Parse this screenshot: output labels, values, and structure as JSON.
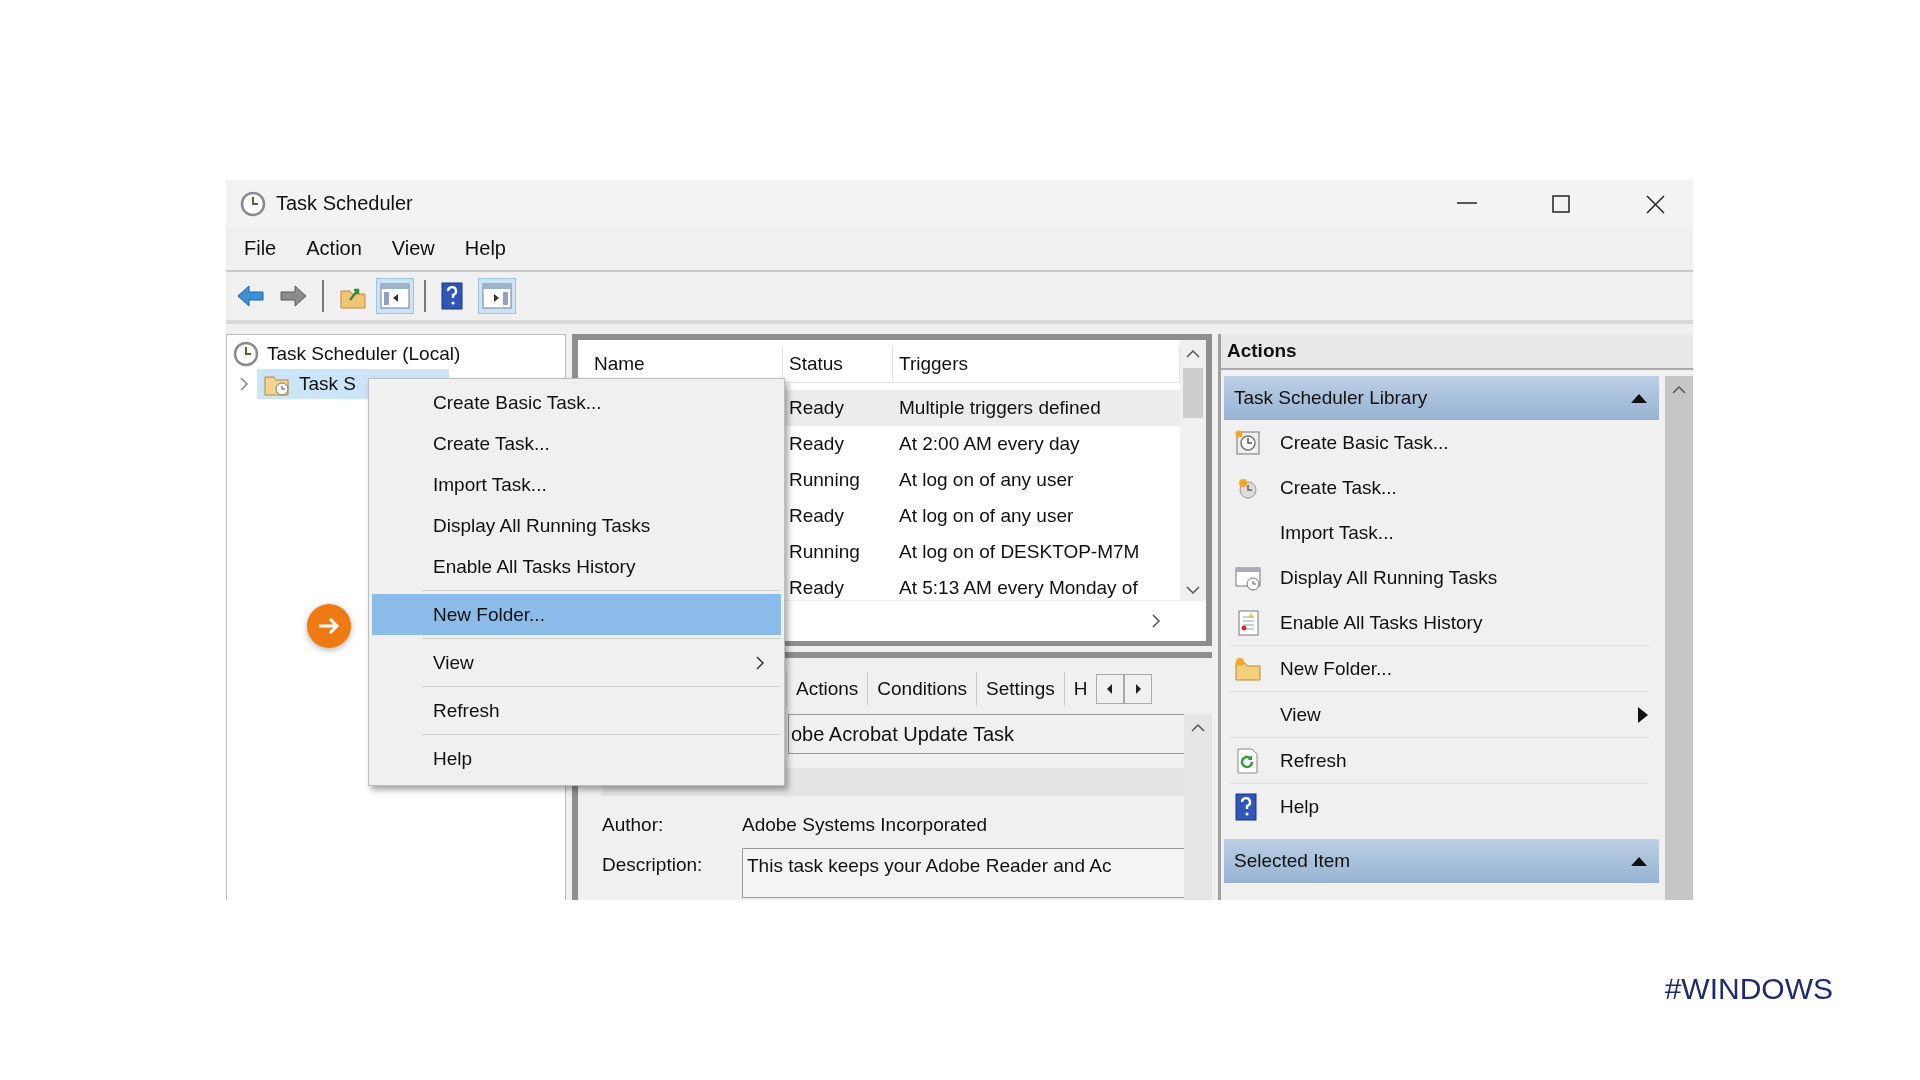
{
  "window": {
    "title": "Task Scheduler"
  },
  "menu_bar": [
    "File",
    "Action",
    "View",
    "Help"
  ],
  "toolbar": [
    [
      {
        "kind": "back",
        "pressed": false
      },
      {
        "kind": "forward",
        "pressed": false
      }
    ],
    [
      {
        "kind": "folder-up",
        "pressed": false
      },
      {
        "kind": "console-tree",
        "pressed": true
      }
    ],
    [
      {
        "kind": "help",
        "pressed": false
      },
      {
        "kind": "action-pane",
        "pressed": true
      }
    ]
  ],
  "tree": {
    "label": "Task Scheduler (Local)",
    "children": [
      {
        "label": "Task S",
        "selected": true,
        "expanded": false
      }
    ]
  },
  "task_list": {
    "columns": [
      "Name",
      "Status",
      "Triggers"
    ],
    "rows": [
      {
        "status": "Ready",
        "triggers": "Multiple triggers defined",
        "selected": true
      },
      {
        "status": "Ready",
        "triggers": "At 2:00 AM every day",
        "selected": false
      },
      {
        "status": "Running",
        "triggers": "At log on of any user",
        "selected": false
      },
      {
        "status": "Ready",
        "triggers": "At log on of any user",
        "selected": false
      },
      {
        "status": "Running",
        "triggers": "At log on of DESKTOP-M7M",
        "selected": false
      },
      {
        "status": "Ready",
        "triggers": "At 5:13 AM every Monday of",
        "selected": false
      }
    ]
  },
  "details": {
    "tabs": [
      {
        "label": "Actions",
        "selected": false
      },
      {
        "label": "Conditions",
        "selected": false
      },
      {
        "label": "Settings",
        "selected": false
      },
      {
        "label": "H",
        "selected": false
      }
    ],
    "name_value": "obe Acrobat Update Task",
    "fields": [
      {
        "kind": "text",
        "label": "Author:",
        "value": "Adobe Systems Incorporated"
      },
      {
        "kind": "box",
        "label": "Description:",
        "value": "This task keeps your Adobe Reader and Ac"
      }
    ]
  },
  "context_menu": {
    "groups": [
      [
        {
          "label": "Create Basic Task...",
          "submenu": false,
          "selected": false
        },
        {
          "label": "Create Task...",
          "submenu": false,
          "selected": false
        },
        {
          "label": "Import Task...",
          "submenu": false,
          "selected": false
        },
        {
          "label": "Display All Running Tasks",
          "submenu": false,
          "selected": false
        },
        {
          "label": "Enable All Tasks History",
          "submenu": false,
          "selected": false
        }
      ],
      [
        {
          "label": "New Folder...",
          "submenu": false,
          "selected": true
        }
      ],
      [
        {
          "label": "View",
          "submenu": true,
          "selected": false
        }
      ],
      [
        {
          "label": "Refresh",
          "submenu": false,
          "selected": false
        }
      ],
      [
        {
          "label": "Help",
          "submenu": false,
          "selected": false
        }
      ]
    ]
  },
  "actions_pane": {
    "title": "Actions",
    "sections": [
      {
        "title": "Task Scheduler Library",
        "expanded": true,
        "groups": [
          [
            {
              "kind": "basic-task",
              "label": "Create Basic Task..."
            },
            {
              "kind": "task",
              "label": "Create Task..."
            },
            {
              "kind": "import",
              "label": "Import Task..."
            },
            {
              "kind": "running",
              "label": "Display All Running Tasks"
            },
            {
              "kind": "history",
              "label": "Enable All Tasks History"
            }
          ],
          [
            {
              "kind": "folder",
              "label": "New Folder..."
            }
          ],
          [
            {
              "kind": "submenu",
              "label": "View"
            }
          ],
          [
            {
              "kind": "refresh",
              "label": "Refresh"
            }
          ],
          [
            {
              "kind": "help",
              "label": "Help"
            }
          ]
        ]
      },
      {
        "title": "Selected Item",
        "expanded": true
      }
    ]
  },
  "tag": "#WINDOWS"
}
